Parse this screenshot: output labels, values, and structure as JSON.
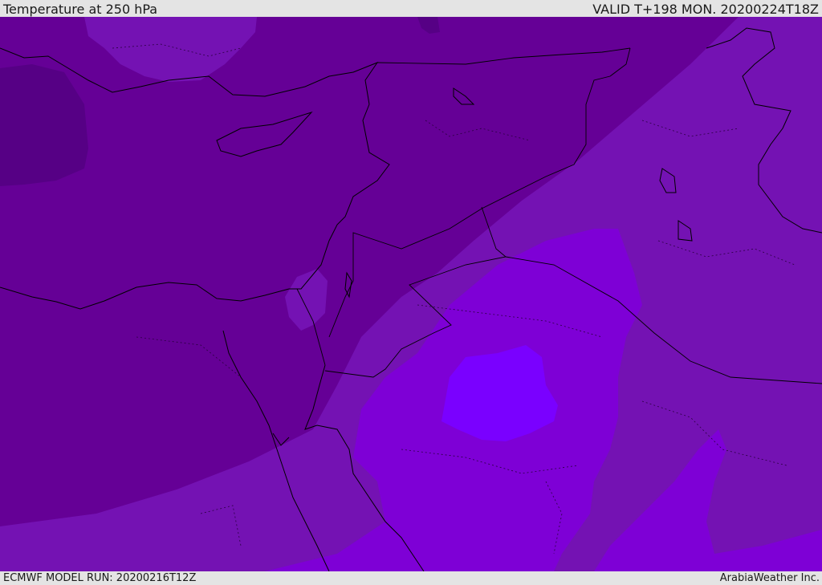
{
  "header": {
    "title": "Temperature at 250 hPa",
    "valid_time": "VALID T+198 MON. 20200224T18Z"
  },
  "footer": {
    "model_run": "ECMWF MODEL RUN: 20200216T12Z",
    "credit": "ArabiaWeather Inc."
  },
  "map": {
    "field": "temperature",
    "level": "250 hPa",
    "colors": {
      "coldest": "#560085",
      "cold": "#650096",
      "mid": "#7412b3",
      "warm": "#7e00d6",
      "warmer": "#8000f0",
      "warmest": "#7a00ff",
      "patch_light": "#7a22c6"
    }
  }
}
